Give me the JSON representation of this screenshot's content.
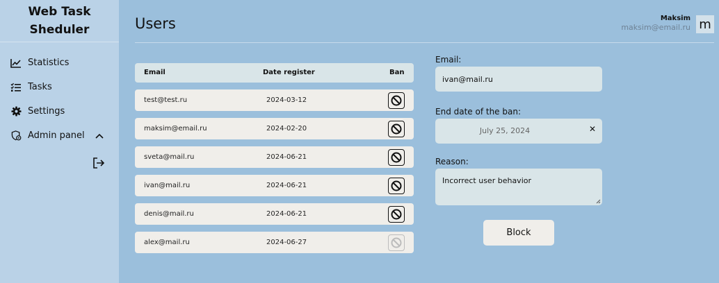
{
  "app": {
    "title_line1": "Web Task",
    "title_line2": "Sheduler"
  },
  "sidebar": {
    "items": [
      {
        "label": "Statistics",
        "icon": "chart-line-icon"
      },
      {
        "label": "Tasks",
        "icon": "checklist-icon"
      },
      {
        "label": "Settings",
        "icon": "gear-icon"
      },
      {
        "label": "Admin panel",
        "icon": "admin-shield-icon",
        "expanded": true
      }
    ],
    "logout_icon": "logout-icon"
  },
  "header": {
    "title": "Users",
    "user_name": "Maksim",
    "user_email": "maksim@email.ru",
    "avatar_letter": "m"
  },
  "table": {
    "columns": {
      "email": "Email",
      "date": "Date register",
      "ban": "Ban"
    },
    "rows": [
      {
        "email": "test@test.ru",
        "date": "2024-03-12",
        "ban_enabled": true
      },
      {
        "email": "maksim@email.ru",
        "date": "2024-02-20",
        "ban_enabled": true
      },
      {
        "email": "sveta@mail.ru",
        "date": "2024-06-21",
        "ban_enabled": true
      },
      {
        "email": "ivan@mail.ru",
        "date": "2024-06-21",
        "ban_enabled": true
      },
      {
        "email": "denis@mail.ru",
        "date": "2024-06-21",
        "ban_enabled": true
      },
      {
        "email": "alex@mail.ru",
        "date": "2024-06-27",
        "ban_enabled": false
      }
    ]
  },
  "form": {
    "email_label": "Email:",
    "email_value": "ivan@mail.ru",
    "end_date_label": "End date of the ban:",
    "end_date_value": "July 25, 2024",
    "clear_symbol": "✕",
    "reason_label": "Reason:",
    "reason_value": "Incorrect user behavior",
    "block_label": "Block"
  },
  "colors": {
    "background": "#9bbfdc",
    "sidebar": "#bad2e7",
    "row": "#f0eeea",
    "field": "#d9e5e8"
  }
}
